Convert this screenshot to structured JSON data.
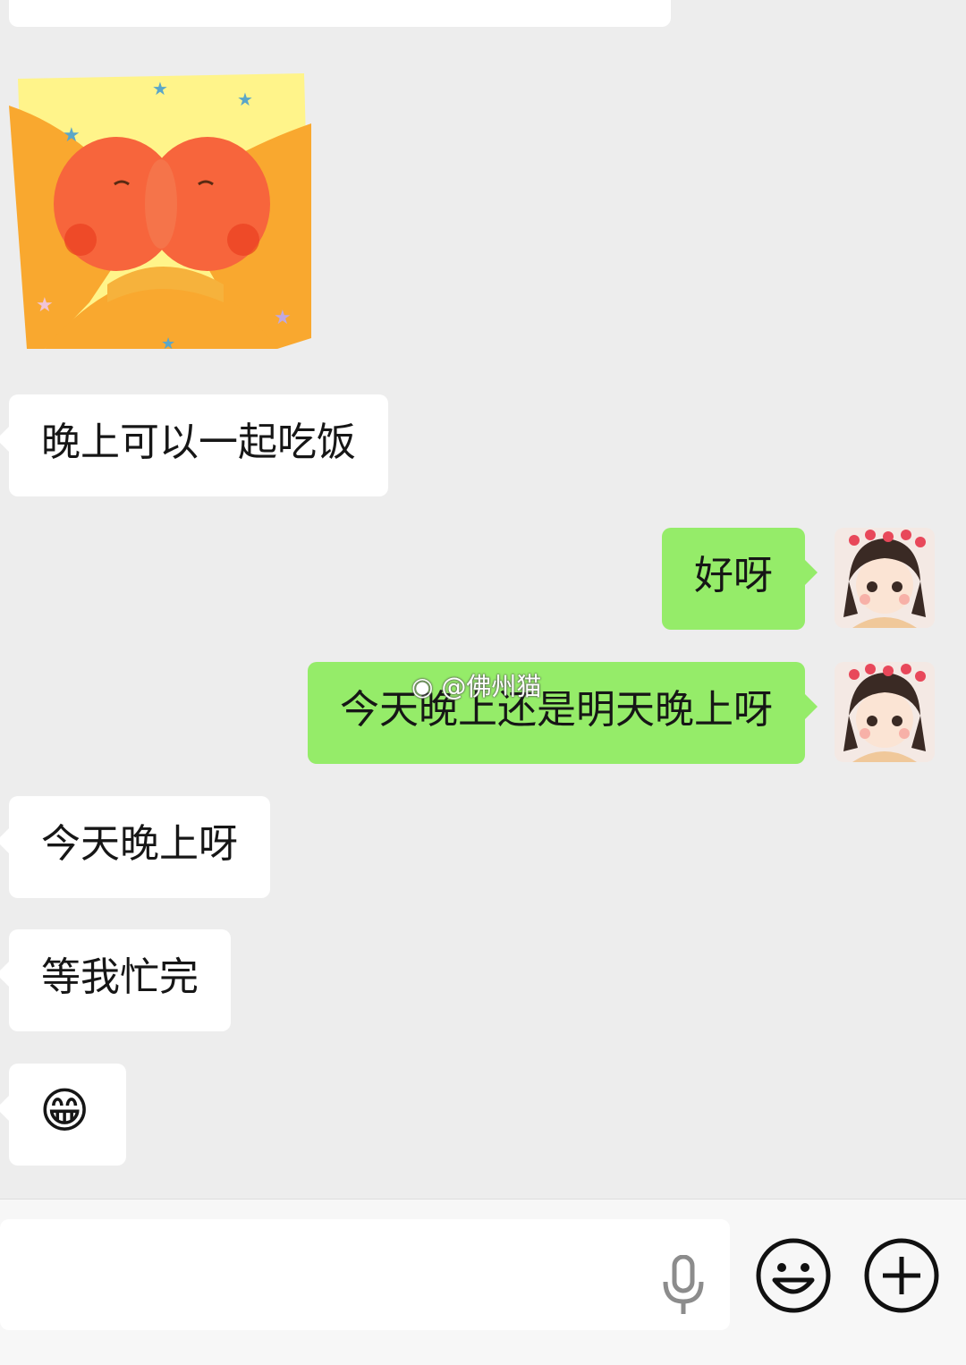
{
  "messages": {
    "m1": "晚上可以一起吃饭",
    "m2": "好呀",
    "m3": "今天晚上还是明天晚上呀",
    "m4": "今天晚上呀",
    "m5": "等我忙完",
    "m6": "😁"
  },
  "watermark": "@佛州猫",
  "icons": {
    "sticker": "kissing-peaches-sticker",
    "voice": "microphone-icon",
    "emoji": "smiley-icon",
    "more": "plus-circle-icon"
  },
  "colors": {
    "background": "#ededed",
    "incoming_bubble": "#ffffff",
    "outgoing_bubble": "#95ec69"
  }
}
